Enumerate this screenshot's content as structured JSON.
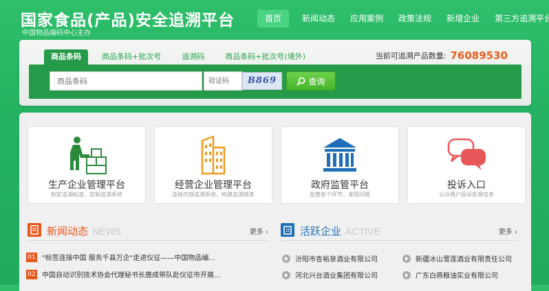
{
  "header": {
    "title": "国家食品(产品)安全追溯平台",
    "subtitle": "中国物品编码中心主办"
  },
  "nav": [
    {
      "label": "首页",
      "active": true
    },
    {
      "label": "新闻动态"
    },
    {
      "label": "应用案例"
    },
    {
      "label": "政策法规"
    },
    {
      "label": "新增企业"
    },
    {
      "label": "第三方追溯平台"
    }
  ],
  "search": {
    "tabs": [
      "商品条码",
      "商品条码+批次号",
      "追溯码",
      "商品条码+批次号(境外)"
    ],
    "count_label": "当前可追溯产品数量:",
    "count_value": "76089530",
    "input_placeholder": "商品条码",
    "captcha_placeholder": "验证码",
    "captcha_text": "B869",
    "button_label": "查询"
  },
  "cards": [
    {
      "title": "生产企业管理平台",
      "desc": "制定追溯标准，定制追溯系统",
      "icon": "worker-boxes-icon"
    },
    {
      "title": "经营企业管理平台",
      "desc": "连接内部追溯系统，构建追溯链条",
      "icon": "buildings-icon"
    },
    {
      "title": "政府监管平台",
      "desc": "监管各个环节，发现问题",
      "icon": "government-building-icon"
    },
    {
      "title": "投诉入口",
      "desc": "公众用户投诉反馈信息",
      "icon": "chat-bubbles-icon"
    }
  ],
  "news": {
    "title": "新闻动态",
    "title_en": "NEWS",
    "more": "更多",
    "items": [
      {
        "num": "01",
        "text": "\"标签连接中国 服务千县万企\"走进仪征——中国物品编..."
      },
      {
        "num": "02",
        "text": "中国自动识别技术协会代理秘书长唐成带队赴仪征市开展..."
      }
    ]
  },
  "companies": {
    "title": "活跃企业",
    "title_en": "ACTIVE",
    "more": "更多",
    "items": [
      "汾阳市杏裕泉酒业有限公司",
      "新疆冰山雪莲酒业有限责任公司",
      "河北兴台酒业集团有限公司",
      "广东白燕粮油实业有限公司"
    ]
  },
  "colors": {
    "brand_green": "#24b262",
    "dark_green": "#259a49",
    "accent_orange": "#e8571c",
    "accent_blue": "#1f6fb8"
  }
}
